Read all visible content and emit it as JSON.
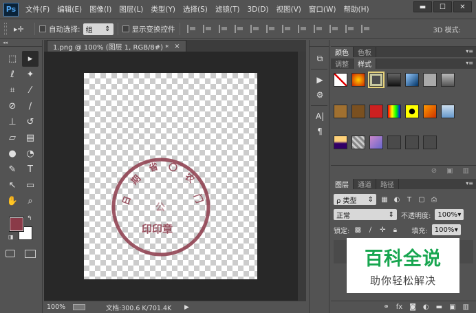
{
  "app": {
    "logo": "Ps"
  },
  "menu": [
    "文件(F)",
    "编辑(E)",
    "图像(I)",
    "图层(L)",
    "类型(Y)",
    "选择(S)",
    "滤镜(T)",
    "3D(D)",
    "视图(V)",
    "窗口(W)",
    "帮助(H)"
  ],
  "window_buttons": {
    "minimize": "▬",
    "restore": "☐",
    "close": "✕"
  },
  "options": {
    "auto_select_label": "自动选择:",
    "auto_select_value": "组",
    "show_transform_label": "显示变换控件",
    "mode_3d_label": "3D 模式:"
  },
  "document": {
    "tab_title": "1.png @ 100% (图层 1, RGB/8#) *",
    "tab_close": "×",
    "zoom": "100%",
    "doc_info": "文档:300.6 K/701.4K"
  },
  "colors": {
    "foreground": "#8a3a48",
    "background": "#ffffff",
    "stamp": "#8c3a4a"
  },
  "stamp": {
    "arc_text": [
      "日",
      "期",
      "省",
      "〇",
      "农",
      "门"
    ],
    "center_text": "公",
    "bottom_text": "印印章"
  },
  "panels": {
    "color_tabs": [
      "颜色",
      "色板"
    ],
    "style_tabs": [
      "调整",
      "样式"
    ],
    "layers_tabs": [
      "图层",
      "通道",
      "路径"
    ],
    "kind_label": "ρ 类型",
    "blend_mode": "正常",
    "opacity_label": "不透明度:",
    "opacity_value": "100%",
    "lock_label": "锁定:",
    "fill_label": "填充:",
    "fill_value": "100%"
  },
  "watermark": {
    "line1": "百科全说",
    "line2": "助你轻松解决"
  }
}
